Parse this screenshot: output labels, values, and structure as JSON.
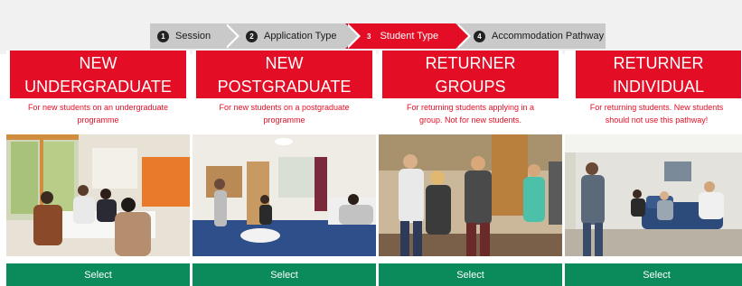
{
  "steps": [
    {
      "number": "1",
      "label": "Session"
    },
    {
      "number": "2",
      "label": "Application Type"
    },
    {
      "number": "3",
      "label": "Student Type"
    },
    {
      "number": "4",
      "label": "Accommodation Pathway"
    }
  ],
  "active_step": "Student Type",
  "cards": [
    {
      "title_line1": "NEW",
      "title_line2": "UNDERGRADUATE",
      "desc_line1": "For new students on an undergraduate",
      "desc_line2": "programme",
      "button": "Select"
    },
    {
      "title_line1": "NEW",
      "title_line2": "POSTGRADUATE",
      "desc_line1": "For new students on a postgraduate",
      "desc_line2": "programme",
      "button": "Select"
    },
    {
      "title_line1": "RETURNER",
      "title_line2": "GROUPS",
      "desc_line1": "For returning students applying in a",
      "desc_line2": "group. Not for new students.",
      "button": "Select"
    },
    {
      "title_line1": "RETURNER",
      "title_line2": "INDIVIDUAL",
      "desc_line1": "For returning students. New students",
      "desc_line2": "should not use this pathway!",
      "button": "Select"
    }
  ],
  "colors": {
    "accent": "#e30e25",
    "select_button": "#0b8a5b",
    "inactive_step": "#c9c9c9"
  }
}
